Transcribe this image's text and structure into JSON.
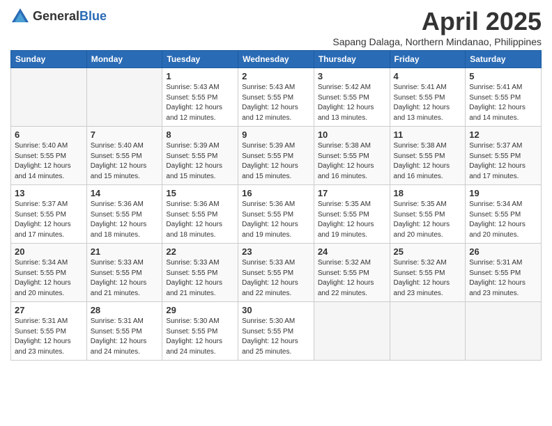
{
  "header": {
    "logo_general": "General",
    "logo_blue": "Blue",
    "title": "April 2025",
    "subtitle": "Sapang Dalaga, Northern Mindanao, Philippines"
  },
  "columns": [
    "Sunday",
    "Monday",
    "Tuesday",
    "Wednesday",
    "Thursday",
    "Friday",
    "Saturday"
  ],
  "weeks": [
    [
      {
        "day": "",
        "info": ""
      },
      {
        "day": "",
        "info": ""
      },
      {
        "day": "1",
        "info": "Sunrise: 5:43 AM\nSunset: 5:55 PM\nDaylight: 12 hours and 12 minutes."
      },
      {
        "day": "2",
        "info": "Sunrise: 5:43 AM\nSunset: 5:55 PM\nDaylight: 12 hours and 12 minutes."
      },
      {
        "day": "3",
        "info": "Sunrise: 5:42 AM\nSunset: 5:55 PM\nDaylight: 12 hours and 13 minutes."
      },
      {
        "day": "4",
        "info": "Sunrise: 5:41 AM\nSunset: 5:55 PM\nDaylight: 12 hours and 13 minutes."
      },
      {
        "day": "5",
        "info": "Sunrise: 5:41 AM\nSunset: 5:55 PM\nDaylight: 12 hours and 14 minutes."
      }
    ],
    [
      {
        "day": "6",
        "info": "Sunrise: 5:40 AM\nSunset: 5:55 PM\nDaylight: 12 hours and 14 minutes."
      },
      {
        "day": "7",
        "info": "Sunrise: 5:40 AM\nSunset: 5:55 PM\nDaylight: 12 hours and 15 minutes."
      },
      {
        "day": "8",
        "info": "Sunrise: 5:39 AM\nSunset: 5:55 PM\nDaylight: 12 hours and 15 minutes."
      },
      {
        "day": "9",
        "info": "Sunrise: 5:39 AM\nSunset: 5:55 PM\nDaylight: 12 hours and 15 minutes."
      },
      {
        "day": "10",
        "info": "Sunrise: 5:38 AM\nSunset: 5:55 PM\nDaylight: 12 hours and 16 minutes."
      },
      {
        "day": "11",
        "info": "Sunrise: 5:38 AM\nSunset: 5:55 PM\nDaylight: 12 hours and 16 minutes."
      },
      {
        "day": "12",
        "info": "Sunrise: 5:37 AM\nSunset: 5:55 PM\nDaylight: 12 hours and 17 minutes."
      }
    ],
    [
      {
        "day": "13",
        "info": "Sunrise: 5:37 AM\nSunset: 5:55 PM\nDaylight: 12 hours and 17 minutes."
      },
      {
        "day": "14",
        "info": "Sunrise: 5:36 AM\nSunset: 5:55 PM\nDaylight: 12 hours and 18 minutes."
      },
      {
        "day": "15",
        "info": "Sunrise: 5:36 AM\nSunset: 5:55 PM\nDaylight: 12 hours and 18 minutes."
      },
      {
        "day": "16",
        "info": "Sunrise: 5:36 AM\nSunset: 5:55 PM\nDaylight: 12 hours and 19 minutes."
      },
      {
        "day": "17",
        "info": "Sunrise: 5:35 AM\nSunset: 5:55 PM\nDaylight: 12 hours and 19 minutes."
      },
      {
        "day": "18",
        "info": "Sunrise: 5:35 AM\nSunset: 5:55 PM\nDaylight: 12 hours and 20 minutes."
      },
      {
        "day": "19",
        "info": "Sunrise: 5:34 AM\nSunset: 5:55 PM\nDaylight: 12 hours and 20 minutes."
      }
    ],
    [
      {
        "day": "20",
        "info": "Sunrise: 5:34 AM\nSunset: 5:55 PM\nDaylight: 12 hours and 20 minutes."
      },
      {
        "day": "21",
        "info": "Sunrise: 5:33 AM\nSunset: 5:55 PM\nDaylight: 12 hours and 21 minutes."
      },
      {
        "day": "22",
        "info": "Sunrise: 5:33 AM\nSunset: 5:55 PM\nDaylight: 12 hours and 21 minutes."
      },
      {
        "day": "23",
        "info": "Sunrise: 5:33 AM\nSunset: 5:55 PM\nDaylight: 12 hours and 22 minutes."
      },
      {
        "day": "24",
        "info": "Sunrise: 5:32 AM\nSunset: 5:55 PM\nDaylight: 12 hours and 22 minutes."
      },
      {
        "day": "25",
        "info": "Sunrise: 5:32 AM\nSunset: 5:55 PM\nDaylight: 12 hours and 23 minutes."
      },
      {
        "day": "26",
        "info": "Sunrise: 5:31 AM\nSunset: 5:55 PM\nDaylight: 12 hours and 23 minutes."
      }
    ],
    [
      {
        "day": "27",
        "info": "Sunrise: 5:31 AM\nSunset: 5:55 PM\nDaylight: 12 hours and 23 minutes."
      },
      {
        "day": "28",
        "info": "Sunrise: 5:31 AM\nSunset: 5:55 PM\nDaylight: 12 hours and 24 minutes."
      },
      {
        "day": "29",
        "info": "Sunrise: 5:30 AM\nSunset: 5:55 PM\nDaylight: 12 hours and 24 minutes."
      },
      {
        "day": "30",
        "info": "Sunrise: 5:30 AM\nSunset: 5:55 PM\nDaylight: 12 hours and 25 minutes."
      },
      {
        "day": "",
        "info": ""
      },
      {
        "day": "",
        "info": ""
      },
      {
        "day": "",
        "info": ""
      }
    ]
  ]
}
